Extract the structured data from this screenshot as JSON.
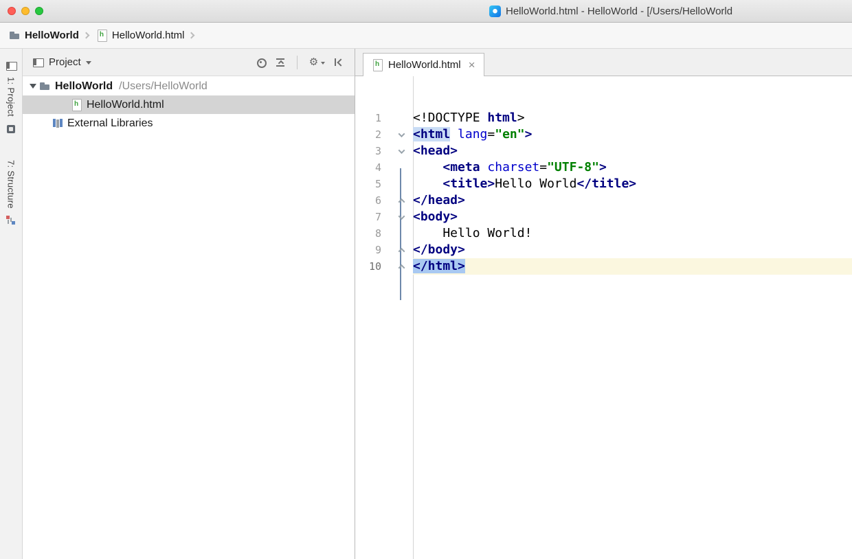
{
  "colors": {
    "tag": "#000080",
    "attribute": "#0000cc",
    "value": "#008000",
    "matched_tag_bg": "#c9dcf5",
    "selection_bg": "#a9c9f2",
    "current_line_bg": "#fbf7df",
    "selected_row_bg": "#d4d4d4"
  },
  "window": {
    "title": "HelloWorld.html - HelloWorld - [/Users/HelloWorld",
    "traffic_lights": [
      "close",
      "minimize",
      "zoom"
    ]
  },
  "nav_bar": {
    "items": [
      {
        "label": "HelloWorld",
        "icon": "folder",
        "bold": true
      },
      {
        "label": "HelloWorld.html",
        "icon": "html",
        "bold": false
      }
    ]
  },
  "tool_stripe": {
    "project_button": {
      "label": "1: Project",
      "icon": "projwin"
    },
    "favorites_button": {
      "icon": "favorites"
    },
    "structure_button": {
      "label": "7: Structure",
      "icon": "structure"
    }
  },
  "project_panel": {
    "header": {
      "title": "Project",
      "toolbar_icons": [
        "locate",
        "collapse-all",
        "separator",
        "gear",
        "hide"
      ]
    },
    "tree": [
      {
        "label": "HelloWorld",
        "suffix": "/Users/HelloWorld",
        "icon": "folder",
        "indent": 0,
        "arrow": "down",
        "bold": true,
        "selected": false
      },
      {
        "label": "HelloWorld.html",
        "suffix": "",
        "icon": "html",
        "indent": 2,
        "arrow": "",
        "bold": false,
        "selected": true
      },
      {
        "label": "External Libraries",
        "suffix": "",
        "icon": "library",
        "indent": 1,
        "arrow": "",
        "bold": false,
        "selected": false
      }
    ]
  },
  "editor": {
    "tabs": [
      {
        "label": "HelloWorld.html",
        "icon": "html",
        "active": true,
        "close": "×"
      }
    ],
    "code": {
      "language": "HTML",
      "lines": [
        {
          "num": "1",
          "fold": "",
          "current": false,
          "segments": [
            {
              "t": "<!DOCTYPE ",
              "c": "plain"
            },
            {
              "t": "html",
              "c": "tag"
            },
            {
              "t": ">",
              "c": "plain"
            }
          ]
        },
        {
          "num": "2",
          "fold": "down",
          "current": false,
          "segments": [
            {
              "t": "<html",
              "c": "tag match"
            },
            {
              "t": " ",
              "c": "plain"
            },
            {
              "t": "lang",
              "c": "attr"
            },
            {
              "t": "=",
              "c": "plain"
            },
            {
              "t": "\"en\"",
              "c": "val"
            },
            {
              "t": ">",
              "c": "tag"
            }
          ]
        },
        {
          "num": "3",
          "fold": "down",
          "current": false,
          "segments": [
            {
              "t": "<head>",
              "c": "tag"
            }
          ]
        },
        {
          "num": "4",
          "fold": "",
          "current": false,
          "segments": [
            {
              "t": "    ",
              "c": "plain"
            },
            {
              "t": "<meta ",
              "c": "tag"
            },
            {
              "t": "charset",
              "c": "attr"
            },
            {
              "t": "=",
              "c": "plain"
            },
            {
              "t": "\"UTF-8\"",
              "c": "val"
            },
            {
              "t": ">",
              "c": "tag"
            }
          ]
        },
        {
          "num": "5",
          "fold": "",
          "current": false,
          "segments": [
            {
              "t": "    ",
              "c": "plain"
            },
            {
              "t": "<title>",
              "c": "tag"
            },
            {
              "t": "Hello World",
              "c": "plain"
            },
            {
              "t": "</title>",
              "c": "tag"
            }
          ]
        },
        {
          "num": "6",
          "fold": "up",
          "current": false,
          "segments": [
            {
              "t": "</head>",
              "c": "tag"
            }
          ]
        },
        {
          "num": "7",
          "fold": "down",
          "current": false,
          "segments": [
            {
              "t": "<body>",
              "c": "tag"
            }
          ]
        },
        {
          "num": "8",
          "fold": "",
          "current": false,
          "segments": [
            {
              "t": "    Hello World!",
              "c": "plain"
            }
          ]
        },
        {
          "num": "9",
          "fold": "up",
          "current": false,
          "segments": [
            {
              "t": "</body>",
              "c": "tag"
            }
          ]
        },
        {
          "num": "10",
          "fold": "up",
          "current": true,
          "segments": [
            {
              "t": "</html>",
              "c": "tag selected"
            }
          ]
        }
      ]
    }
  }
}
